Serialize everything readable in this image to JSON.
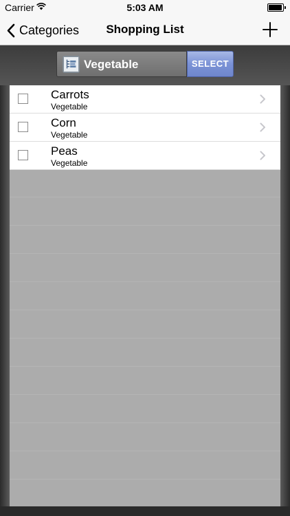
{
  "status_bar": {
    "carrier": "Carrier",
    "time": "5:03 AM",
    "wifi_icon": "wifi-icon",
    "battery_icon": "battery-icon"
  },
  "nav": {
    "back_label": "Categories",
    "back_icon": "chevron-left-icon",
    "title": "Shopping List",
    "add_icon": "plus-icon"
  },
  "selector": {
    "category": "Vegetable",
    "category_icon": "list-tree-icon",
    "select_label": "SELECT"
  },
  "items": [
    {
      "name": "Carrots",
      "category": "Vegetable",
      "checked": false
    },
    {
      "name": "Corn",
      "category": "Vegetable",
      "checked": false
    },
    {
      "name": "Peas",
      "category": "Vegetable",
      "checked": false
    }
  ],
  "colors": {
    "select_button": "#7b92d6",
    "panel_background": "#acacac",
    "frame_dark": "#2b2b2b"
  }
}
